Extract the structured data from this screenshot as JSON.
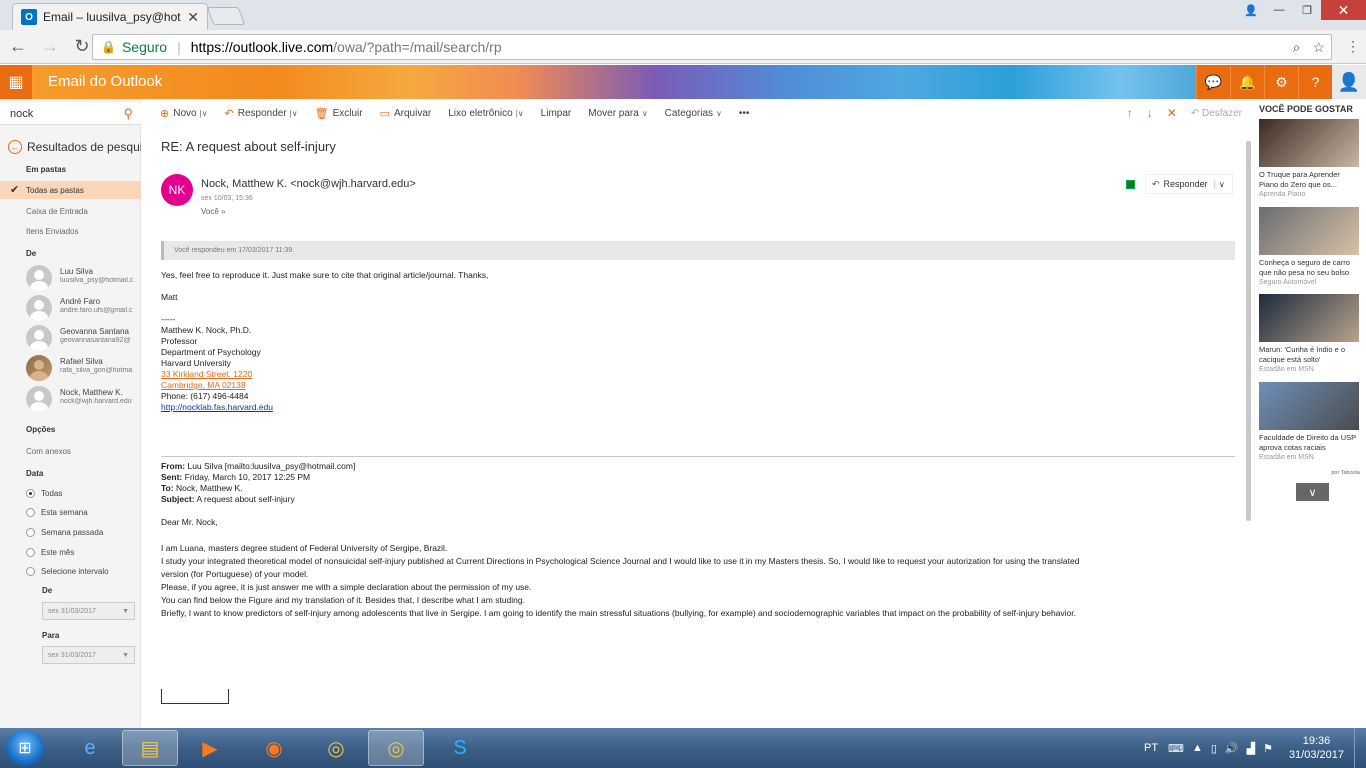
{
  "browser": {
    "tab_title": "Email – luusilva_psy@hot",
    "favicon": "O",
    "secure_label": "Seguro",
    "url_domain": "https://outlook.live.com",
    "url_path": "/owa/?path=/mail/search/rp"
  },
  "header": {
    "app_title": "Email do Outlook"
  },
  "left": {
    "search_value": "nock",
    "results_title": "Resultados de pesquisa",
    "in_folders": "Em pastas",
    "all_folders": "Todas as pastas",
    "folders": [
      "Caixa de Entrada",
      "Itens Enviados"
    ],
    "from_label": "De",
    "people": [
      {
        "name": "Luu Silva",
        "email": "luusilva_psy@hotmail.c"
      },
      {
        "name": "André Faro",
        "email": "andre.faro.ufs@gmail.c"
      },
      {
        "name": "Geovanna Santana",
        "email": "geovannasantana92@"
      },
      {
        "name": "Rafael Silva",
        "email": "rafa_silva_gon@hotma"
      },
      {
        "name": "Nock, Matthew K.",
        "email": "nock@wjh.harvard.edu"
      }
    ],
    "options_label": "Opções",
    "with_attachments": "Com anexos",
    "date_label": "Data",
    "date_options": [
      "Todas",
      "Esta semana",
      "Semana passada",
      "Este mês",
      "Selecione intervalo"
    ],
    "from_date_label": "De",
    "from_date": "sex 31/03/2017",
    "to_date_label": "Para",
    "to_date": "sex 31/03/2017"
  },
  "toolbar": {
    "new": "Novo",
    "reply": "Responder",
    "delete": "Excluir",
    "archive": "Arquivar",
    "junk": "Lixo eletrônico",
    "clean": "Limpar",
    "move": "Mover para",
    "categories": "Categorias",
    "more": "•••",
    "undo": "Desfazer"
  },
  "message": {
    "subject": "RE: A request about self-injury",
    "initials": "NK",
    "sender": "Nock, Matthew K. <nock@wjh.harvard.edu>",
    "date": "sex 10/03, 15:36",
    "to": "Você",
    "reply_button": "Responder",
    "replied_notice": "Você respondeu em 17/03/2017 11:39.",
    "body": [
      "Yes, feel free to reproduce it. Just make sure to cite that original article/journal. Thanks,",
      "Matt"
    ],
    "signature": {
      "dashes": "-----",
      "name": "Matthew K. Nock, Ph.D.",
      "title": "Professor",
      "dept": "Department of Psychology",
      "univ": "Harvard University",
      "addr1": "33 Kirkland Street, 1220",
      "addr2": "Cambridge, MA 02138",
      "phone": "Phone: (617) 496-4484",
      "site": "http://nocklab.fas.harvard.edu"
    },
    "original": {
      "from_label": "From:",
      "from": "Luu Silva [mailto:luusilva_psy@hotmail.com]",
      "sent_label": "Sent:",
      "sent": "Friday, March 10, 2017 12:25 PM",
      "to_label": "To:",
      "to": "Nock, Matthew K.",
      "subject_label": "Subject:",
      "subject": "A request about self-injury",
      "greeting": "Dear Mr. Nock,",
      "lines": [
        "I am Luana, masters degree student of Federal University of Sergipe, Brazil.",
        "I study your integrated theoretical model of nonsuicidal self-injury published at Current Directions in Psychological Science Journal and I would like to use it in my Masters thesis. So, I would like to request your autorization for using the translated",
        "version (for Portuguese) of your model.",
        "Please, if you agree, it is just answer me with a simple declaration about the permission of my use.",
        "You can find below the Figure and my translation of it. Besides that, I describe what I am studing.",
        "Briefly, I want to know predictors of self-injury among adolescents that live in Sergipe. I am going to identify the main stressful situations (bullying, for example) and sociodemographic variables that impact on the probability of self-injury behavior."
      ]
    }
  },
  "ads": {
    "title": "VOCÊ PODE GOSTAR",
    "items": [
      {
        "caption": "O Truque para Aprender Piano do Zero que os...",
        "source": "Aprenda Piano",
        "colors": [
          "#3b2a22",
          "#c9b6a4"
        ]
      },
      {
        "caption": "Conheça o seguro de carro que não pesa no seu bolso",
        "source": "Seguro Automóvel",
        "colors": [
          "#6a6c70",
          "#d8c1a6"
        ]
      },
      {
        "caption": "Marun: 'Cunha é índio e o cacique está solto'",
        "source": "Estadão em MSN",
        "colors": [
          "#1e2a40",
          "#b8a38a"
        ]
      },
      {
        "caption": "Faculdade de Direito da USP aprova cotas raciais",
        "source": "Estadão em MSN",
        "colors": [
          "#6f8fb8",
          "#4b4c4e"
        ]
      }
    ],
    "by": "por Taboola"
  },
  "taskbar": {
    "lang": "PT",
    "time": "19:36",
    "date": "31/03/2017"
  }
}
